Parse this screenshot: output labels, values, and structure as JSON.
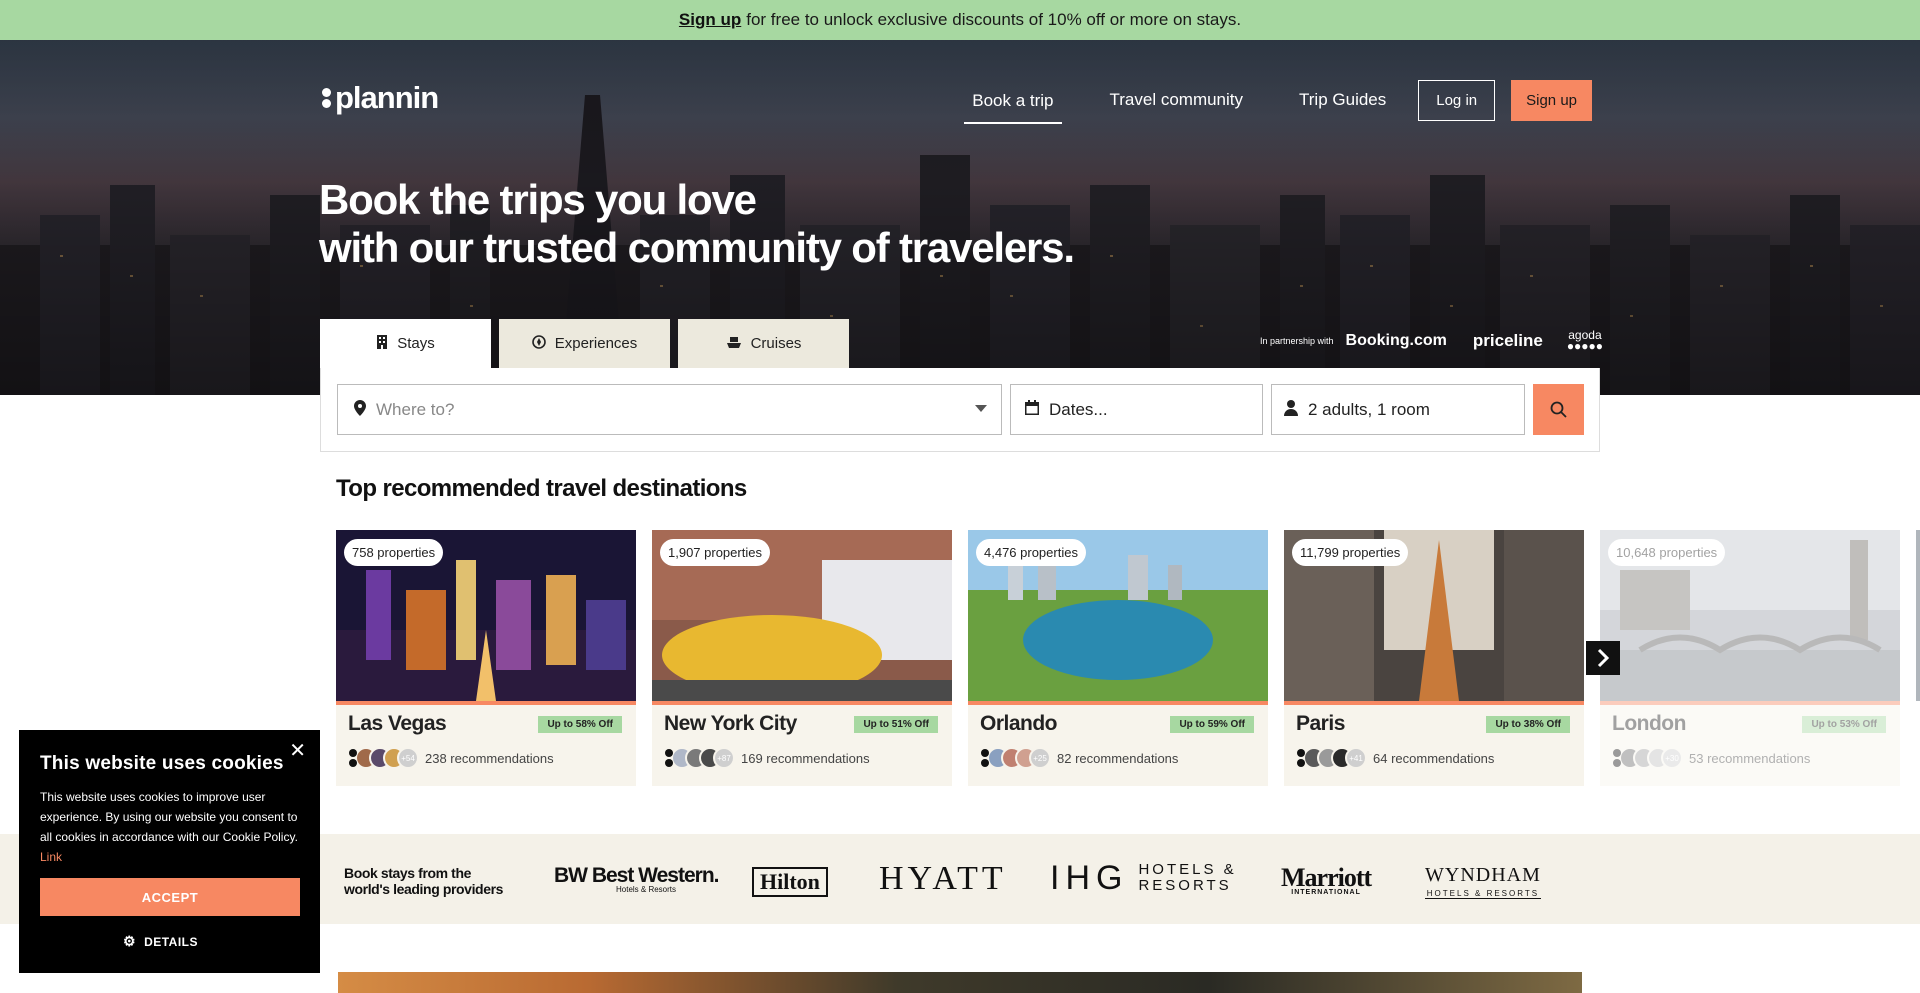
{
  "promo": {
    "link": "Sign up",
    "text": "for free to unlock exclusive discounts of 10% off or more on stays."
  },
  "brand": {
    "name": "plannin"
  },
  "nav": {
    "items": [
      {
        "label": "Book a trip",
        "active": true
      },
      {
        "label": "Travel community",
        "active": false
      },
      {
        "label": "Trip Guides",
        "active": false
      }
    ],
    "login": "Log in",
    "signup": "Sign up"
  },
  "hero": {
    "line1": "Book the trips you love",
    "line2": "with our trusted community of travelers."
  },
  "tabs": [
    {
      "label": "Stays",
      "icon": "building-icon",
      "active": true
    },
    {
      "label": "Experiences",
      "icon": "compass-icon",
      "active": false
    },
    {
      "label": "Cruises",
      "icon": "ship-icon",
      "active": false
    }
  ],
  "partners": {
    "intro": "In partnership with",
    "names": [
      "Booking.com",
      "priceline",
      "agoda"
    ]
  },
  "search": {
    "where_placeholder": "Where to?",
    "dates_placeholder": "Dates...",
    "guests_value": "2 adults, 1 room"
  },
  "section": {
    "title": "Top recommended travel destinations"
  },
  "destinations": [
    {
      "name": "Las Vegas",
      "properties": "758 properties",
      "deal": "Up to 58% Off",
      "more": "+54",
      "recommendations": "238 recommendations"
    },
    {
      "name": "New York City",
      "properties": "1,907 properties",
      "deal": "Up to 51% Off",
      "more": "+87",
      "recommendations": "169 recommendations"
    },
    {
      "name": "Orlando",
      "properties": "4,476 properties",
      "deal": "Up to 59% Off",
      "more": "+25",
      "recommendations": "82 recommendations"
    },
    {
      "name": "Paris",
      "properties": "11,799 properties",
      "deal": "Up to 38% Off",
      "more": "+41",
      "recommendations": "64 recommendations"
    },
    {
      "name": "London",
      "properties": "10,648 properties",
      "deal": "Up to 53% Off",
      "more": "+30",
      "recommendations": "53 recommendations"
    }
  ],
  "providers": {
    "lead_line1": "Book stays from the",
    "lead_line2": "world's leading providers",
    "brands": {
      "bestwestern": "BW Best Western.",
      "bestwestern_sub": "Hotels & Resorts",
      "hilton": "Hilton",
      "hyatt": "HYATT",
      "ihg": "IHG",
      "ihg_sub1": "HOTELS &",
      "ihg_sub2": "RESORTS",
      "marriott": "Marriott",
      "marriott_sub": "INTERNATIONAL",
      "wyndham": "WYNDHAM",
      "wyndham_sub": "HOTELS & RESORTS"
    }
  },
  "cookie": {
    "title": "This website uses cookies",
    "body": "This website uses cookies to improve user experience. By using our website you consent to all cookies in accordance with our Cookie Policy.",
    "link": "Link",
    "accept": "ACCEPT",
    "details": "DETAILS"
  },
  "colors": {
    "accent": "#f78862",
    "promo_green": "#a7d8a1",
    "cream": "#f4f1e8"
  }
}
